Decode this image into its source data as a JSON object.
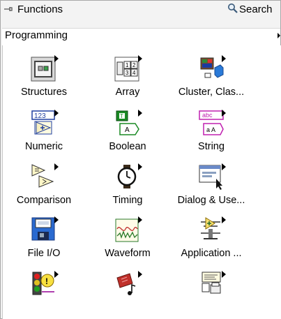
{
  "window": {
    "title": "Functions",
    "search_label": "Search",
    "icons": [
      "pin-icon",
      "search-icon"
    ]
  },
  "category": {
    "label": "Programming",
    "arrow": "submenu-arrow-icon"
  },
  "palette": {
    "items": [
      {
        "label": "Structures",
        "icon": "structures-icon"
      },
      {
        "label": "Array",
        "icon": "array-icon"
      },
      {
        "label": "Cluster, Clas...",
        "icon": "cluster-class-icon"
      },
      {
        "label": "Numeric",
        "icon": "numeric-icon"
      },
      {
        "label": "Boolean",
        "icon": "boolean-icon"
      },
      {
        "label": "String",
        "icon": "string-icon"
      },
      {
        "label": "Comparison",
        "icon": "comparison-icon"
      },
      {
        "label": "Timing",
        "icon": "timing-icon"
      },
      {
        "label": "Dialog & Use...",
        "icon": "dialog-user-interface-icon"
      },
      {
        "label": "File I/O",
        "icon": "file-io-icon"
      },
      {
        "label": "Waveform",
        "icon": "waveform-icon"
      },
      {
        "label": "Application ...",
        "icon": "application-control-icon"
      },
      {
        "label": "",
        "icon": "synchronization-icon"
      },
      {
        "label": "",
        "icon": "graphics-sound-icon"
      },
      {
        "label": "",
        "icon": "report-generation-icon"
      }
    ]
  },
  "colors": {
    "background": "#f3f3f3",
    "palette_background": "#ffffff",
    "numeric_blue": "#1f3fa0",
    "boolean_green": "#1a8a24",
    "string_magenta": "#c020b0"
  }
}
